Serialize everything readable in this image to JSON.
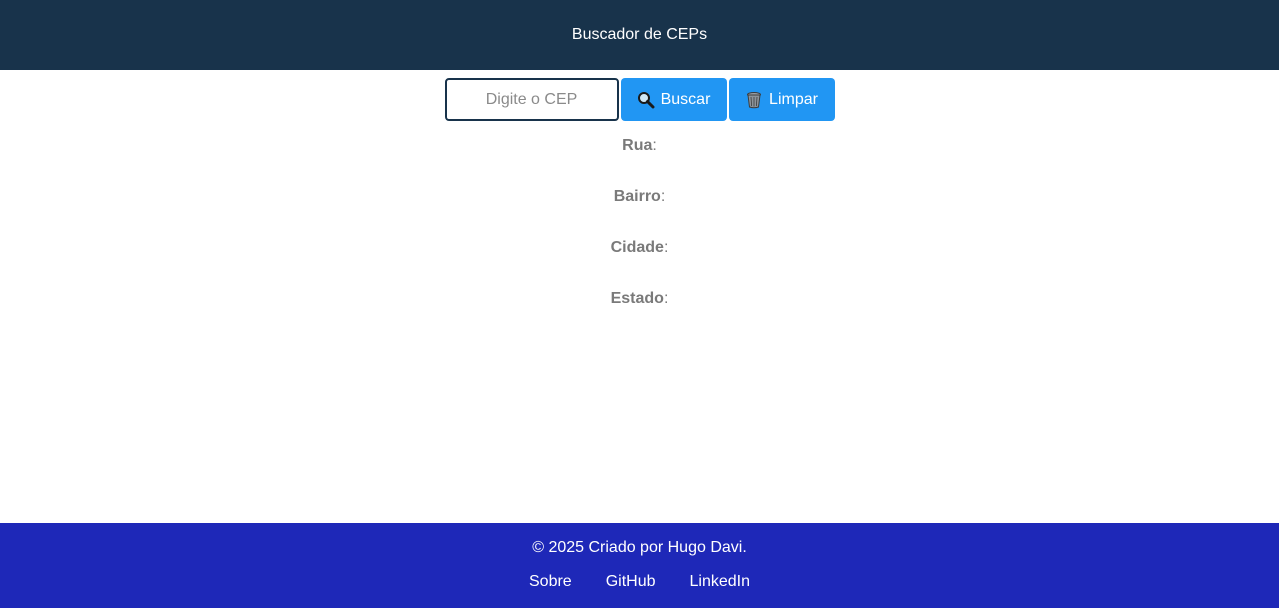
{
  "header": {
    "title": "Buscador de CEPs"
  },
  "search": {
    "placeholder": "Digite o CEP",
    "value": "",
    "search_label": "Buscar",
    "search_icon": "magnifying-glass",
    "clear_label": "Limpar",
    "clear_icon": "wastebasket"
  },
  "results": {
    "street_label": "Rua",
    "neighborhood_label": "Bairro",
    "city_label": "Cidade",
    "state_label": "Estado",
    "separator": ":"
  },
  "footer": {
    "copyright": "© 2025 Criado por Hugo Davi.",
    "links": [
      {
        "label": "Sobre"
      },
      {
        "label": "GitHub"
      },
      {
        "label": "LinkedIn"
      }
    ]
  },
  "colors": {
    "header_bg": "#18334b",
    "button_bg": "#2196f3",
    "footer_bg": "#1e28b8",
    "label_text": "#7a7a7a"
  }
}
